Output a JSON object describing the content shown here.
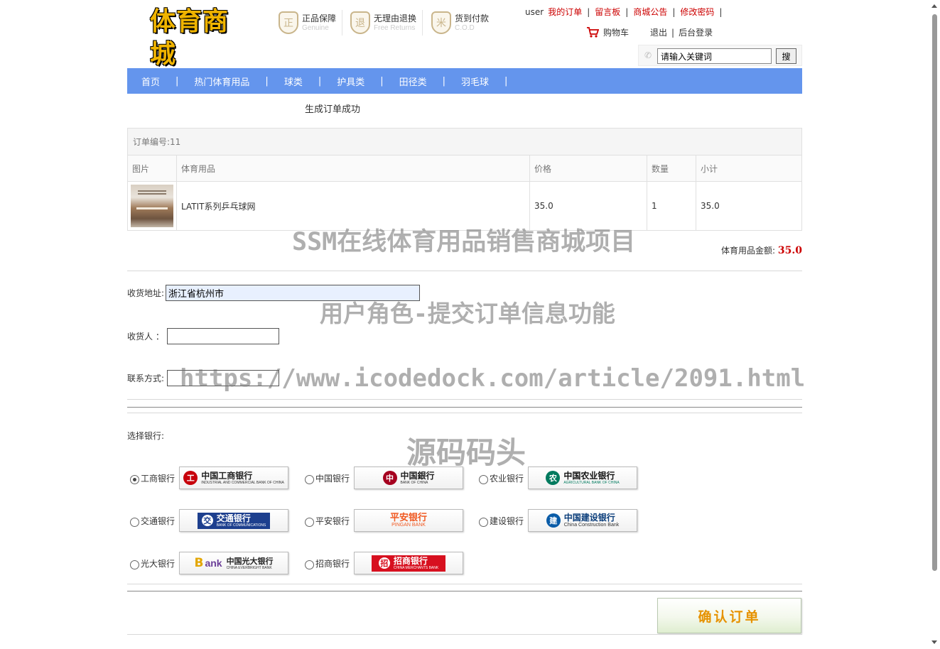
{
  "header": {
    "logo_text": "体育商城",
    "promises": [
      {
        "icon": "genuine-badge-icon",
        "glyph": "正",
        "title": "正品保障",
        "sub": "Genuine"
      },
      {
        "icon": "free-returns-badge-icon",
        "glyph": "退",
        "title": "无理由退换",
        "sub": "Free Returns"
      },
      {
        "icon": "cod-badge-icon",
        "glyph": "米",
        "title": "货到付款",
        "sub": "C.O.D"
      }
    ],
    "user": "user",
    "links": [
      "我的订单",
      "留言板",
      "商城公告",
      "修改密码"
    ],
    "cart": "购物车",
    "logout": "退出",
    "admin_login": "后台登录",
    "search": {
      "value": "请输入关键词",
      "button": "搜"
    }
  },
  "nav": [
    "首页",
    "热门体育用品",
    "球类",
    "护具类",
    "田径类",
    "羽毛球"
  ],
  "order": {
    "success_msg": "生成订单成功",
    "order_no_label": "订单编号:11",
    "columns": [
      "图片",
      "体育用品",
      "价格",
      "数量",
      "小计"
    ],
    "rows": [
      {
        "name": "LATIT系列乒乓球网",
        "price": "35.0",
        "qty": "1",
        "subtotal": "35.0"
      }
    ],
    "total_label": "体育用品金额:",
    "total_value": "35.0"
  },
  "form": {
    "address_label": "收货地址:",
    "address_value": "浙江省杭州市",
    "receiver_label": "收货人 ：",
    "receiver_value": "",
    "contact_label": "联系方式:",
    "contact_value": ""
  },
  "banks": {
    "label": "选择银行:",
    "selected": "工商银行",
    "items": [
      {
        "name": "工商银行",
        "logo_cn": "中国工商银行",
        "logo_en": "INDUSTRIAL AND COMMERCIAL BANK OF CHINA",
        "color": "#c7000b",
        "glyph": "工"
      },
      {
        "name": "中国银行",
        "logo_cn": "中国銀行",
        "logo_en": "BANK OF CHINA",
        "color": "#a5001f",
        "glyph": "中"
      },
      {
        "name": "农业银行",
        "logo_cn": "中国农业银行",
        "logo_en": "AGRICULTURAL BANK OF CHINA",
        "color": "#007a5e",
        "glyph": "农"
      },
      {
        "name": "交通银行",
        "logo_cn": "交通银行",
        "logo_en": "BANK OF COMMUNICATIONS",
        "color": "#1d3f8e",
        "glyph": "交"
      },
      {
        "name": "平安银行",
        "logo_cn": "平安银行",
        "logo_en": "PINGAN BANK",
        "color": "#f05a23",
        "glyph": ""
      },
      {
        "name": "建设银行",
        "logo_cn": "中国建设银行",
        "logo_en": "China Construction Bank",
        "color": "#0a5ca8",
        "glyph": "建"
      },
      {
        "name": "光大银行",
        "logo_cn": "中国光大银行",
        "logo_en": "CHINA EVERBRIGHT BANK",
        "color": "#6b3e98",
        "glyph": "B"
      },
      {
        "name": "招商银行",
        "logo_cn": "招商银行",
        "logo_en": "CHINA MERCHANTS BANK",
        "color": "#d7101f",
        "glyph": "招"
      }
    ]
  },
  "confirm_button": "确认订单",
  "watermarks": [
    "SSM在线体育用品销售商城项目",
    "用户角色-提交订单信息功能",
    "https://www.icodedock.com/article/2091.html",
    "源码码头"
  ]
}
